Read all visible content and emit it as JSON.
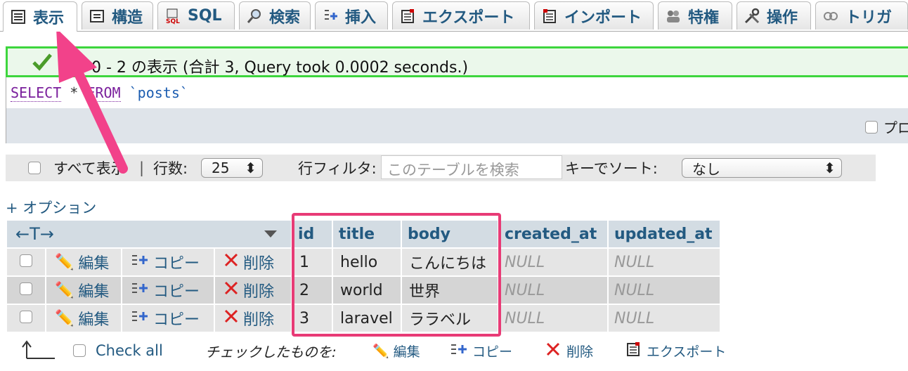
{
  "tabs": [
    {
      "label": "表示",
      "icon": "browse-icon",
      "active": true
    },
    {
      "label": "構造",
      "icon": "structure-icon"
    },
    {
      "label": "SQL",
      "icon": "sql-icon"
    },
    {
      "label": "検索",
      "icon": "search-icon"
    },
    {
      "label": "挿入",
      "icon": "insert-icon"
    },
    {
      "label": "エクスポート",
      "icon": "export-icon"
    },
    {
      "label": "インポート",
      "icon": "import-icon"
    },
    {
      "label": "特権",
      "icon": "privileges-icon"
    },
    {
      "label": "操作",
      "icon": "operations-icon"
    },
    {
      "label": "トリガ",
      "icon": "triggers-icon"
    }
  ],
  "message": {
    "text": "行 0 - 2 の表示 (合計 3, Query took 0.0002 seconds.)"
  },
  "sql": {
    "keyword": "SELECT",
    "star": "*",
    "from": "FROM",
    "table": "`posts`",
    "profiling_label": "プロ"
  },
  "nav": {
    "show_all": "すべて表示",
    "separator": "|",
    "rows_label": "行数:",
    "rows_value": "25",
    "filter_label": "行フィルタ:",
    "filter_placeholder": "このテーブルを検索",
    "sort_label": "キーでソート:",
    "sort_value": "なし"
  },
  "options_link": "+ オプション",
  "table": {
    "resize_label": "←T→",
    "columns": [
      "id",
      "title",
      "body",
      "created_at",
      "updated_at"
    ],
    "actions": {
      "edit": "編集",
      "copy": "コピー",
      "delete": "削除"
    },
    "rows": [
      {
        "id": "1",
        "title": "hello",
        "body": "こんにちは",
        "created_at": "NULL",
        "updated_at": "NULL"
      },
      {
        "id": "2",
        "title": "world",
        "body": "世界",
        "created_at": "NULL",
        "updated_at": "NULL"
      },
      {
        "id": "3",
        "title": "laravel",
        "body": "ララベル",
        "created_at": "NULL",
        "updated_at": "NULL"
      }
    ]
  },
  "bottom": {
    "check_all": "Check all",
    "with_selected": "チェックしたものを:",
    "edit": "編集",
    "copy": "コピー",
    "delete": "削除",
    "export": "エクスポート"
  },
  "colors": {
    "accent": "#235a81",
    "highlight": "#e83b76",
    "success_border": "#3dd63d"
  }
}
